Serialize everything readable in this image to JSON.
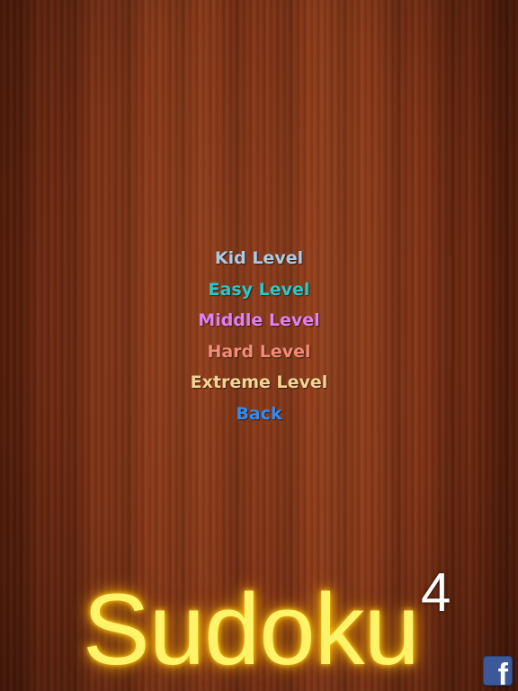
{
  "menu": {
    "items": [
      {
        "label": "Kid Level",
        "color": "#a9cbe6"
      },
      {
        "label": "Easy Level",
        "color": "#27c9c9"
      },
      {
        "label": "Middle Level",
        "color": "#e07ff0"
      },
      {
        "label": "Hard Level",
        "color": "#f08b76"
      },
      {
        "label": "Extreme Level",
        "color": "#f2d596"
      },
      {
        "label": "Back",
        "color": "#2e8cf5"
      }
    ]
  },
  "title": {
    "text": "Sudoku",
    "superscript": "4",
    "color": "#fff36a"
  },
  "facebook": {
    "glyph": "f",
    "icon": "facebook-icon",
    "color": "#3b5998"
  }
}
